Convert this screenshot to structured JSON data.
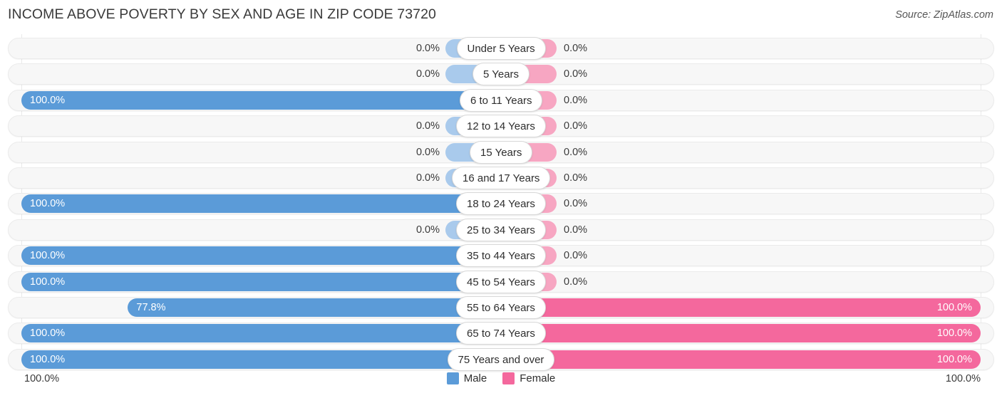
{
  "header": {
    "title": "INCOME ABOVE POVERTY BY SEX AND AGE IN ZIP CODE 73720",
    "source": "Source: ZipAtlas.com"
  },
  "footer": {
    "axis_min": "100.0%",
    "axis_max": "100.0%"
  },
  "legend": {
    "items": [
      {
        "label": "Male",
        "color": "#5b9bd8"
      },
      {
        "label": "Female",
        "color": "#f4689d"
      }
    ]
  },
  "colors": {
    "male": "#5b9bd8",
    "male_zero": "#a9caec",
    "female": "#f4689d",
    "female_zero": "#f7a6c2",
    "track": "#f7f7f7",
    "pill": "#ffffff"
  },
  "chart_data": {
    "type": "bar",
    "subtype": "diverging-bidirectional",
    "title": "INCOME ABOVE POVERTY BY SEX AND AGE IN ZIP CODE 73720",
    "xlabel": "",
    "ylabel": "",
    "xlim": [
      100.0,
      100.0
    ],
    "grid": true,
    "legend_position": "bottom-center",
    "categories": [
      "Under 5 Years",
      "5 Years",
      "6 to 11 Years",
      "12 to 14 Years",
      "15 Years",
      "16 and 17 Years",
      "18 to 24 Years",
      "25 to 34 Years",
      "35 to 44 Years",
      "45 to 54 Years",
      "55 to 64 Years",
      "65 to 74 Years",
      "75 Years and over"
    ],
    "series": [
      {
        "name": "Male",
        "direction": "left",
        "values": [
          0.0,
          0.0,
          100.0,
          0.0,
          0.0,
          0.0,
          100.0,
          0.0,
          100.0,
          100.0,
          77.8,
          100.0,
          100.0
        ],
        "labels": [
          "0.0%",
          "0.0%",
          "100.0%",
          "0.0%",
          "0.0%",
          "0.0%",
          "100.0%",
          "0.0%",
          "100.0%",
          "100.0%",
          "77.8%",
          "100.0%",
          "100.0%"
        ]
      },
      {
        "name": "Female",
        "direction": "right",
        "values": [
          0.0,
          0.0,
          0.0,
          0.0,
          0.0,
          0.0,
          0.0,
          0.0,
          0.0,
          0.0,
          100.0,
          100.0,
          100.0
        ],
        "labels": [
          "0.0%",
          "0.0%",
          "0.0%",
          "0.0%",
          "0.0%",
          "0.0%",
          "0.0%",
          "0.0%",
          "0.0%",
          "0.0%",
          "100.0%",
          "100.0%",
          "100.0%"
        ]
      }
    ]
  }
}
